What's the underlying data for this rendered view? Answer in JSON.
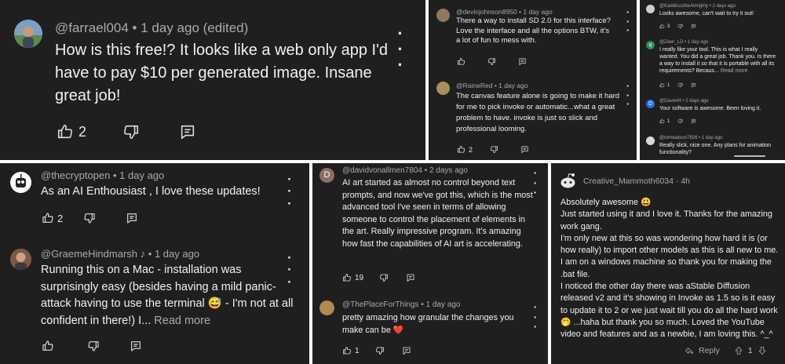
{
  "panel1": {
    "author": "@farrael004",
    "time": "1 day ago (edited)",
    "text": "How is this free!? It looks like a web only app I'd have to pay $10 per generated image. Insane great job!",
    "likes": "2"
  },
  "panel2": {
    "c1": {
      "author": "@devinjohnson8950",
      "time": "1 day ago",
      "text": "There a way to install SD 2.0 for this interface? Love the interface and all the options BTW, it's a lot of fun to mess with."
    },
    "c2": {
      "author": "@RaineRed",
      "time": "1 day ago",
      "text": "The canvas feature alone is going to make it hard for me to pick invoke or automatic...what a great problem to have. invoke is just so slick and professional looming.",
      "likes": "2"
    }
  },
  "panel3": {
    "c1": {
      "author": "@KaddicustheAlmighty",
      "time": "2 days ago",
      "text": "Looks awesome, can't wait to try it out!",
      "likes": "3"
    },
    "c2": {
      "initial": "q",
      "author": "@Zwer_LD",
      "time": "1 day ago",
      "text": "I really like your tool. This is what I really wanted. You did a great job. Thank you. Is there a way to install it so that it is portable with all its requirements? Becaus...",
      "read_more": "Read more",
      "likes": "1"
    },
    "c3": {
      "initial": "D",
      "author": "@DavenH",
      "time": "2 days ago",
      "text": "Your software is awesome. Been loving it.",
      "likes": "1"
    },
    "c4": {
      "author": "@tomwatson7826",
      "time": "1 day ago",
      "text": "Really slick, nice one. Any plans for animation functionality?"
    }
  },
  "panel4": {
    "c1": {
      "author": "@thecryptopen",
      "time": "1 day ago",
      "text": "As an AI Enthousiast , I love these updates!",
      "likes": "2"
    },
    "c2": {
      "author": "@GraemeHindmarsh",
      "note": "♪",
      "time": "1 day ago",
      "text": "Running this on a Mac - installation was surprisingly easy (besides having a mild panic-attack having to use the terminal 😅 - I'm not at all confident in there!) I...",
      "read_more": "Read more"
    }
  },
  "panel5": {
    "c1": {
      "initial": "D",
      "author": "@davidvonallmen7804",
      "time": "2 days ago",
      "text": "AI art started as almost no control beyond text prompts, and now we've got this, which is the most advanced tool I've seen in terms of allowing someone to control the placement of elements in the art. Really impressive program. It's amazing how fast the capabilities of AI art is accelerating.",
      "likes": "19"
    },
    "c2": {
      "author": "@ThePlaceForThings",
      "time": "1 day ago",
      "text": "pretty amazing how granular the changes you make can be ❤️",
      "likes": "1"
    }
  },
  "panel6": {
    "author": "Creative_Mammoth6034",
    "time": "4h",
    "text": "Absolutely awesome 😃\nJust started using it and I love it. Thanks for the amazing work gang.\nI'm only new at this so was wondering how hard it is (or how really) to import other models as this is all new to me. I am on a windows machine so thank you for making the .bat file.\nI noticed the other day there was aStable Diffusion released v2 and it's showing in Invoke as 1.5 so is it easy to update it to 2 or we just wait till you do all the hard work 🤭 ...haha but thank you so much. Loved the YouTube video and features and as a newbie, I am loving this. ^_^",
    "reply": "Reply",
    "votes": "1"
  },
  "colors": {
    "panel_bg": "#1f1f1f",
    "text": "#f1f1f1",
    "meta": "#aaaaaa",
    "divider": "#ffffff"
  }
}
